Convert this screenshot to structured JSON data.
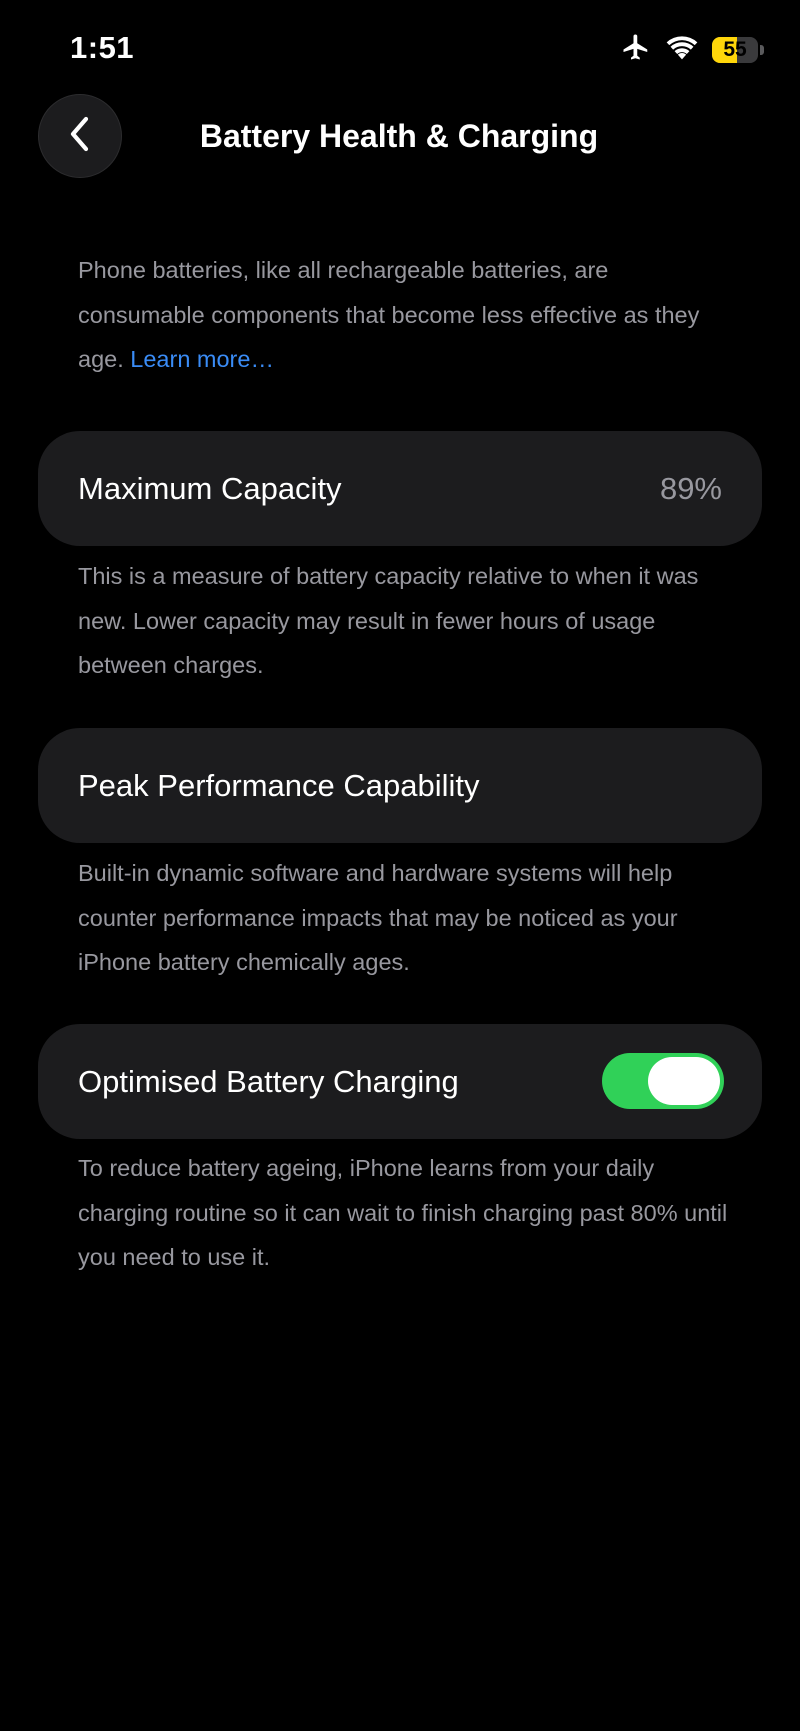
{
  "status_bar": {
    "time": "1:51",
    "battery_level": "55",
    "battery_fraction": 0.55,
    "battery_color": "#ffd60a",
    "icons": [
      "airplane-icon",
      "wifi-icon",
      "battery-icon"
    ]
  },
  "nav": {
    "back_icon": "chevron-left-icon",
    "title": "Battery Health & Charging"
  },
  "intro": {
    "text": "Phone batteries, like all rechargeable batteries, are consumable components that become less effective as they age. ",
    "link_text": "Learn more…",
    "link_color": "#3a8cf6"
  },
  "maximum_capacity": {
    "label": "Maximum Capacity",
    "value": "89%",
    "footer": "This is a measure of battery capacity relative to when it was new. Lower capacity may result in fewer hours of usage between charges."
  },
  "peak_performance": {
    "label": "Peak Performance Capability",
    "footer": "Built-in dynamic software and hardware systems will help counter performance impacts that may be noticed as your iPhone battery chemically ages."
  },
  "optimised_charging": {
    "label": "Optimised Battery Charging",
    "enabled": true,
    "toggle_color": "#30d158",
    "footer": "To reduce battery ageing, iPhone learns from your daily charging routine so it can wait to finish charging past 80% until you need to use it."
  }
}
